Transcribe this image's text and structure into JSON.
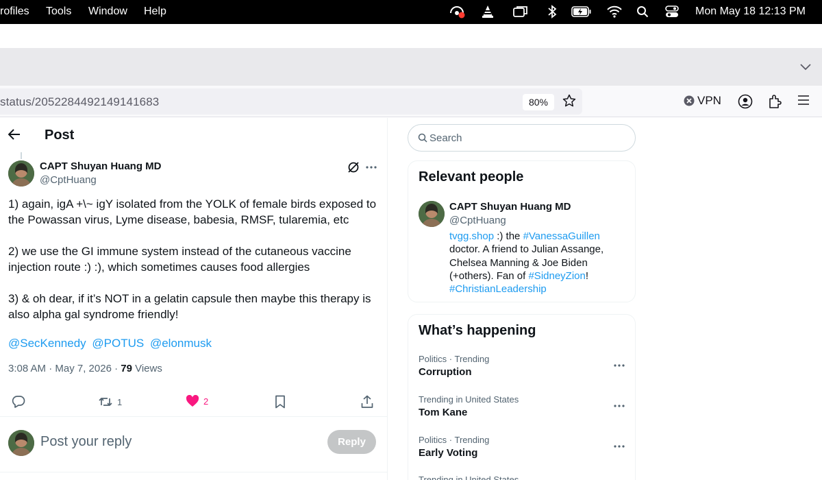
{
  "menubar": {
    "items": [
      "rofiles",
      "Tools",
      "Window",
      "Help"
    ],
    "clock": "Mon May 18  12:13 PM"
  },
  "browser": {
    "url": "status/2052284492149141683",
    "zoom": "80%",
    "vpn_label": "VPN"
  },
  "post": {
    "header_title": "Post",
    "author_name": "CAPT Shuyan Huang MD",
    "author_handle": "@CptHuang",
    "body": [
      "1) again, igA +\\~ igY isolated from the YOLK of female birds exposed to the Powassan virus, Lyme disease, babesia, RMSF, tularemia, etc",
      "2) we use the GI immune system instead of the cutaneous vaccine injection route :) :), which sometimes causes food allergies",
      "3) & oh dear, if it’s NOT in a gelatin capsule then maybe this therapy is also alpha gal syndrome friendly!"
    ],
    "mentions": [
      "@SecKennedy",
      "@POTUS",
      "@elonmusk"
    ],
    "timestamp": "3:08 AM · May 7, 2026 · ",
    "views_count": "79",
    "views_label": " Views",
    "retweets": "1",
    "likes": "2",
    "like_color": "#f91880",
    "reply_placeholder": "Post your reply",
    "reply_button": "Reply"
  },
  "sidebar": {
    "search_placeholder": "Search",
    "relevant_people": {
      "title": "Relevant people",
      "name": "CAPT Shuyan Huang MD",
      "handle": "@CptHuang",
      "bio": {
        "link1": "tvgg.shop",
        "text1": " :) the ",
        "tag1": "#VanessaGuillen",
        "text2": " doctor. A friend to Julian Assange, Chelsea Manning & Joe Biden (+others). Fan of ",
        "tag2": "#SidneyZion",
        "text3": "! ",
        "tag3": "#ChristianLeadership"
      }
    },
    "whats_happening": {
      "title": "What’s happening",
      "trends": [
        {
          "context": "Politics · Trending",
          "name": "Corruption"
        },
        {
          "context": "Trending in United States",
          "name": "Tom Kane"
        },
        {
          "context": "Politics · Trending",
          "name": "Early Voting"
        },
        {
          "context": "Trending in United States",
          "name": ""
        }
      ]
    }
  },
  "colors": {
    "link": "#1d9bf0",
    "secondary_text": "#536471"
  }
}
